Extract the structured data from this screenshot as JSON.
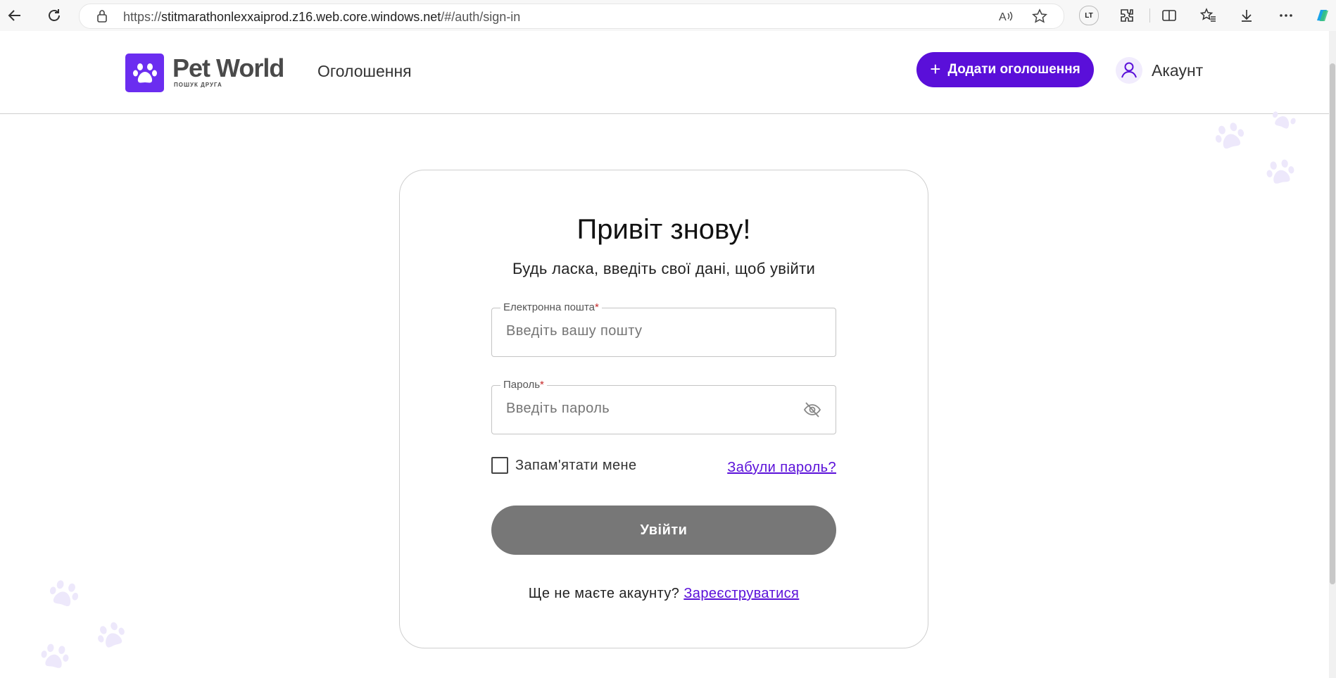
{
  "browser": {
    "url_prefix": "https://",
    "url_host": "stitmarathonlexxaiprod.z16.web.core.windows.net",
    "url_path": "/#/auth/sign-in",
    "extension_label": "LT"
  },
  "header": {
    "logo_title": "Pet World",
    "logo_subtitle": "пошук друга",
    "nav_ads": "Оголошення",
    "add_button_plus": "+",
    "add_button_label": "Додати оголошення",
    "account_label": "Акаунт"
  },
  "login": {
    "title": "Привіт знову!",
    "subtitle": "Будь ласка, введіть свої дані, щоб увійти",
    "email_label": "Електронна пошта",
    "email_placeholder": "Введіть вашу пошту",
    "password_label": "Пароль",
    "password_placeholder": "Введіть пароль",
    "required_mark": "*",
    "remember_label": "Запам'ятати мене",
    "forgot_link": "Забули пароль?",
    "submit_label": "Увійти",
    "no_account_text": "Ще не маєте акаунту?",
    "register_link": "Зареєструватися",
    "remember_checked": false
  },
  "colors": {
    "brand": "#5a0fd9",
    "logo_bg": "#6b2df0",
    "disabled_button": "#777777",
    "paw_decoration": "#ede8fb"
  },
  "icons": [
    "back-arrow-icon",
    "refresh-icon",
    "lock-icon",
    "read-aloud-icon",
    "favorite-star-icon",
    "extensions-icon",
    "split-screen-icon",
    "favorites-icon",
    "downloads-icon",
    "more-icon",
    "copilot-icon",
    "paw-icon",
    "user-icon",
    "eye-off-icon"
  ]
}
